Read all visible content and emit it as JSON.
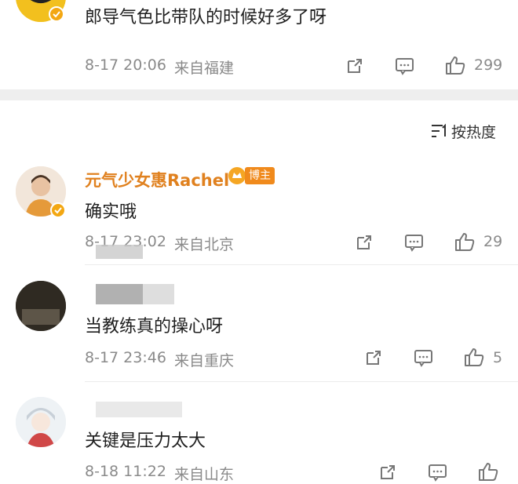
{
  "comments": [
    {
      "text": "郎导气色比带队的时候好多了呀",
      "time": "8-17 20:06",
      "location": "来自福建",
      "likes": "299"
    },
    {
      "username": "元气少女惠Rachel",
      "badge": "博主",
      "text": "确实哦",
      "time": "8-17 23:02",
      "location": "来自北京",
      "likes": "29"
    },
    {
      "text": "当教练真的操心呀",
      "time": "8-17 23:46",
      "location": "来自重庆",
      "likes": "5"
    },
    {
      "text": "关键是压力太大",
      "time": "8-18 11:22",
      "location": "来自山东",
      "likes": ""
    }
  ],
  "sort": {
    "label": "按热度"
  },
  "colors": {
    "accent": "#e0811f",
    "badge": "#f08a1c",
    "muted": "#8a8a8a",
    "divider": "#eeeeee"
  }
}
